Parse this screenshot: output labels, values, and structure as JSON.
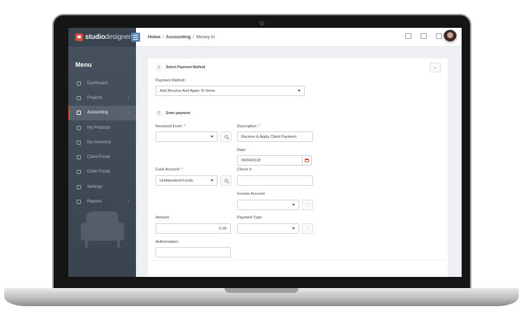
{
  "brand": {
    "name_bold": "studio",
    "name_thin": "designer"
  },
  "breadcrumb": {
    "home": "Home",
    "section": "Accounting",
    "page": "Money In",
    "separator": "/"
  },
  "sidebar": {
    "title": "Menu",
    "items": [
      {
        "label": "Dashboard",
        "icon": "home-icon",
        "active": false,
        "chevron": false
      },
      {
        "label": "Projects",
        "icon": "projects-icon",
        "active": false,
        "chevron": true
      },
      {
        "label": "Accounting",
        "icon": "accounting-icon",
        "active": true,
        "chevron": true
      },
      {
        "label": "My Products",
        "icon": "products-icon",
        "active": false,
        "chevron": false
      },
      {
        "label": "My Inventory",
        "icon": "inventory-icon",
        "active": false,
        "chevron": false
      },
      {
        "label": "Client Portal",
        "icon": "client-portal-icon",
        "active": false,
        "chevron": false
      },
      {
        "label": "Order Portal",
        "icon": "order-portal-icon",
        "active": false,
        "chevron": false
      },
      {
        "label": "Settings",
        "icon": "settings-icon",
        "active": false,
        "chevron": false
      },
      {
        "label": "Reports",
        "icon": "reports-icon",
        "active": false,
        "chevron": true
      }
    ],
    "chevron_glyph": "›"
  },
  "topbar": {
    "icons": [
      "chat-icon",
      "document-icon",
      "mail-icon"
    ]
  },
  "form": {
    "step1": {
      "number": "1",
      "title": "Select Payment Method"
    },
    "payment_method": {
      "label": "Payment Method:",
      "value": "Add Receive And Apply To Items"
    },
    "step2": {
      "number": "2",
      "title": "Enter payment"
    },
    "received_from": {
      "label": "Received From:",
      "required": "*",
      "value": ""
    },
    "description": {
      "label": "Description:",
      "required": "*",
      "value": "Receive & Apply Client Payment"
    },
    "date": {
      "label": "Date:",
      "value": "09/04/2018"
    },
    "cash_account": {
      "label": "Cash Account:",
      "required": "*",
      "value": "Undeposited Funds"
    },
    "check_number": {
      "label": "Check #:",
      "value": ""
    },
    "income_account": {
      "label": "Income Account:",
      "value": ""
    },
    "amount": {
      "label": "Amount:",
      "value": "0.00"
    },
    "payment_type": {
      "label": "Payment Type:",
      "value": ""
    },
    "authorization": {
      "label": "Authorization:",
      "value": ""
    },
    "collapse_glyph": "–",
    "more_glyph": "⋮"
  },
  "colors": {
    "accent": "#d64b3a",
    "sidebar": "#414b56",
    "toggle": "#5f86b3"
  }
}
